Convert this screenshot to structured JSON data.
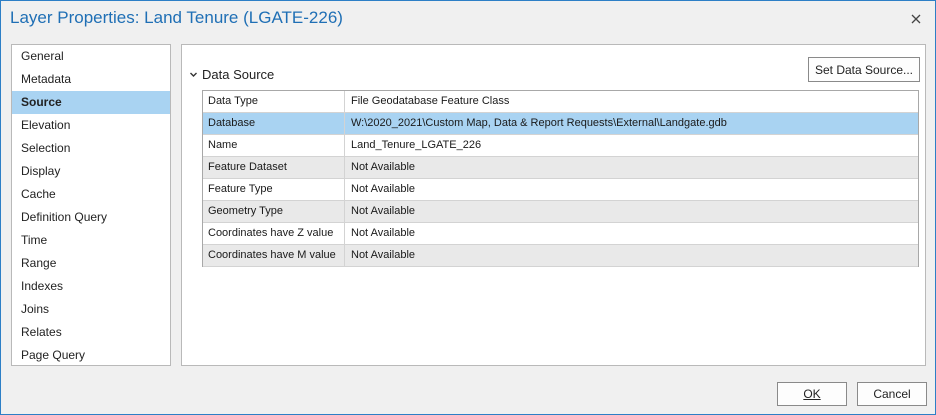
{
  "window": {
    "title": "Layer Properties: Land Tenure (LGATE-226)",
    "close_icon": "close-icon",
    "accent": "#1f6fb5"
  },
  "sidebar": {
    "items": [
      {
        "label": "General"
      },
      {
        "label": "Metadata"
      },
      {
        "label": "Source",
        "selected": true
      },
      {
        "label": "Elevation"
      },
      {
        "label": "Selection"
      },
      {
        "label": "Display"
      },
      {
        "label": "Cache"
      },
      {
        "label": "Definition Query"
      },
      {
        "label": "Time"
      },
      {
        "label": "Range"
      },
      {
        "label": "Indexes"
      },
      {
        "label": "Joins"
      },
      {
        "label": "Relates"
      },
      {
        "label": "Page Query"
      }
    ],
    "selected_color": "#a9d3f2"
  },
  "section": {
    "title": "Data Source",
    "expander_icon": "chevron-down-icon",
    "set_source_label": "Set Data Source..."
  },
  "properties": [
    {
      "label": "Data Type",
      "value": "File Geodatabase Feature Class"
    },
    {
      "label": "Database",
      "value": "W:\\2020_2021\\Custom Map, Data & Report Requests\\External\\Landgate.gdb",
      "selected": true
    },
    {
      "label": "Name",
      "value": "Land_Tenure_LGATE_226"
    },
    {
      "label": "Feature Dataset",
      "value": "Not Available"
    },
    {
      "label": "Feature Type",
      "value": "Not Available"
    },
    {
      "label": "Geometry Type",
      "value": "Not Available"
    },
    {
      "label": "Coordinates have Z value",
      "value": "Not Available"
    },
    {
      "label": "Coordinates have M value",
      "value": "Not Available"
    }
  ],
  "footer": {
    "ok_label": "OK",
    "cancel_label": "Cancel"
  }
}
